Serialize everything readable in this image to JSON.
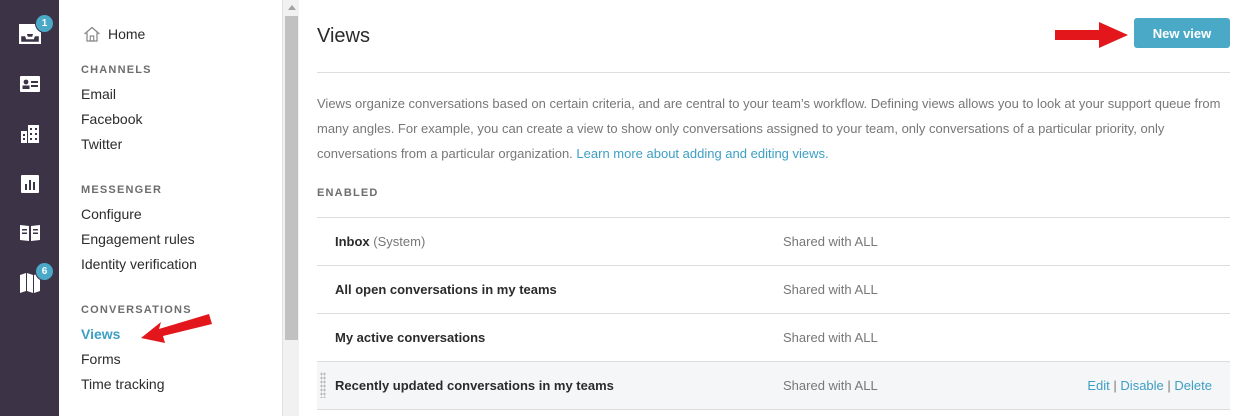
{
  "rail": {
    "inbox_badge": "1",
    "roadmap_badge": "6"
  },
  "nav": {
    "home_label": "Home",
    "sections": {
      "channels": "CHANNELS",
      "messenger": "MESSENGER",
      "conversations": "CONVERSATIONS"
    },
    "channels": [
      "Email",
      "Facebook",
      "Twitter"
    ],
    "messenger": [
      "Configure",
      "Engagement rules",
      "Identity verification"
    ],
    "conversations": [
      "Views",
      "Forms",
      "Time tracking"
    ]
  },
  "main": {
    "title": "Views",
    "new_view_label": "New view",
    "description": "Views organize conversations based on certain criteria, and are central to your team’s workflow. Defining views allows you to look at your support queue from many angles. For example, you can create a view to show only conversations assigned to your team, only conversations of a particular priority, only conversations from a particular organization.",
    "learn_more": "Learn more about adding and editing views.",
    "enabled_label": "ENABLED",
    "rows": [
      {
        "name": "Inbox",
        "suffix": "(System)",
        "shared": "Shared with ALL"
      },
      {
        "name": "All open conversations in my teams",
        "shared": "Shared with ALL"
      },
      {
        "name": "My active conversations",
        "shared": "Shared with ALL"
      },
      {
        "name": "Recently updated conversations in my teams",
        "shared": "Shared with ALL",
        "actions": {
          "edit": "Edit",
          "sep": "|",
          "disable": "Disable",
          "delete": "Delete"
        }
      }
    ]
  },
  "colors": {
    "rail_bg": "#3c3346",
    "accent": "#4ba9c8",
    "link": "#3d9fc4",
    "arrow": "#e3161b"
  }
}
